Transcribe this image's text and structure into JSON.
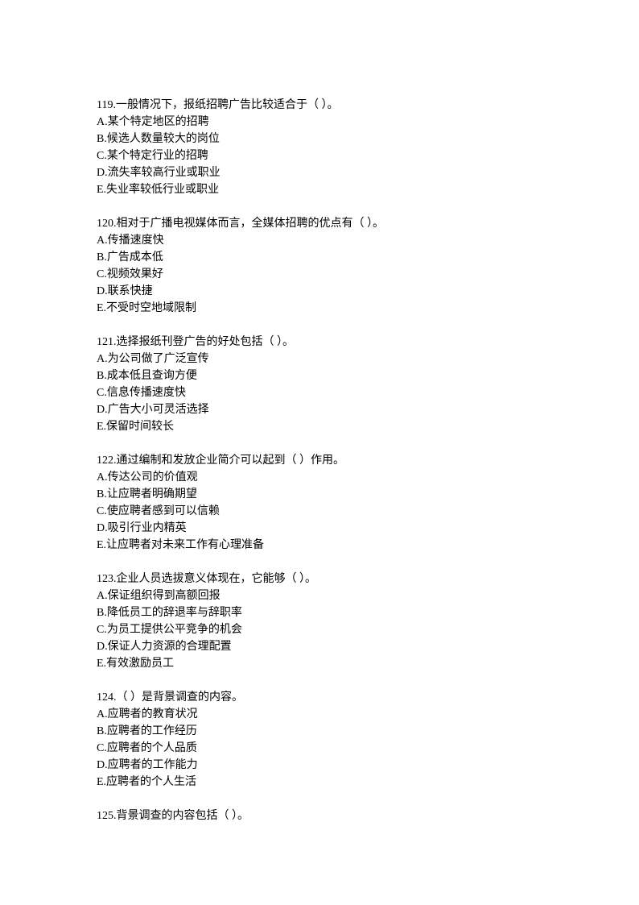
{
  "questions": [
    {
      "number": "119.",
      "text": "一般情况下，报纸招聘广告比较适合于（  ）。",
      "options": [
        "A.某个特定地区的招聘",
        "B.候选人数量较大的岗位",
        "C.某个特定行业的招聘",
        "D.流失率较高行业或职业",
        "E.失业率较低行业或职业"
      ]
    },
    {
      "number": "120.",
      "text": "相对于广播电视媒体而言，全媒体招聘的优点有（  ）。",
      "options": [
        "A.传播速度快",
        "B.广告成本低",
        "C.视频效果好",
        "D.联系快捷",
        "E.不受时空地域限制"
      ]
    },
    {
      "number": "121.",
      "text": "选择报纸刊登广告的好处包括（  ）。",
      "options": [
        "A.为公司做了广泛宣传",
        "B.成本低且查询方便",
        "C.信息传播速度快",
        "D.广告大小可灵活选择",
        "E.保留时间较长"
      ]
    },
    {
      "number": "122.",
      "text": "通过编制和发放企业简介可以起到（  ）作用。",
      "options": [
        "A.传达公司的价值观",
        "B.让应聘者明确期望",
        "C.使应聘者感到可以信赖",
        "D.吸引行业内精英",
        "E.让应聘者对未来工作有心理准备"
      ]
    },
    {
      "number": "123.",
      "text": "企业人员选拔意义体现在，它能够（  ）。",
      "options": [
        "A.保证组织得到高额回报",
        "B.降低员工的辞退率与辞职率",
        "C.为员工提供公平竞争的机会",
        "D.保证人力资源的合理配置",
        "E.有效激励员工"
      ]
    },
    {
      "number": "124.",
      "text": "（   ）是背景调查的内容。",
      "options": [
        "A.应聘者的教育状况",
        "B.应聘者的工作经历",
        "C.应聘者的个人品质",
        "D.应聘者的工作能力",
        "E.应聘者的个人生活"
      ]
    },
    {
      "number": "125.",
      "text": "背景调查的内容包括（  ）。",
      "options": []
    }
  ]
}
